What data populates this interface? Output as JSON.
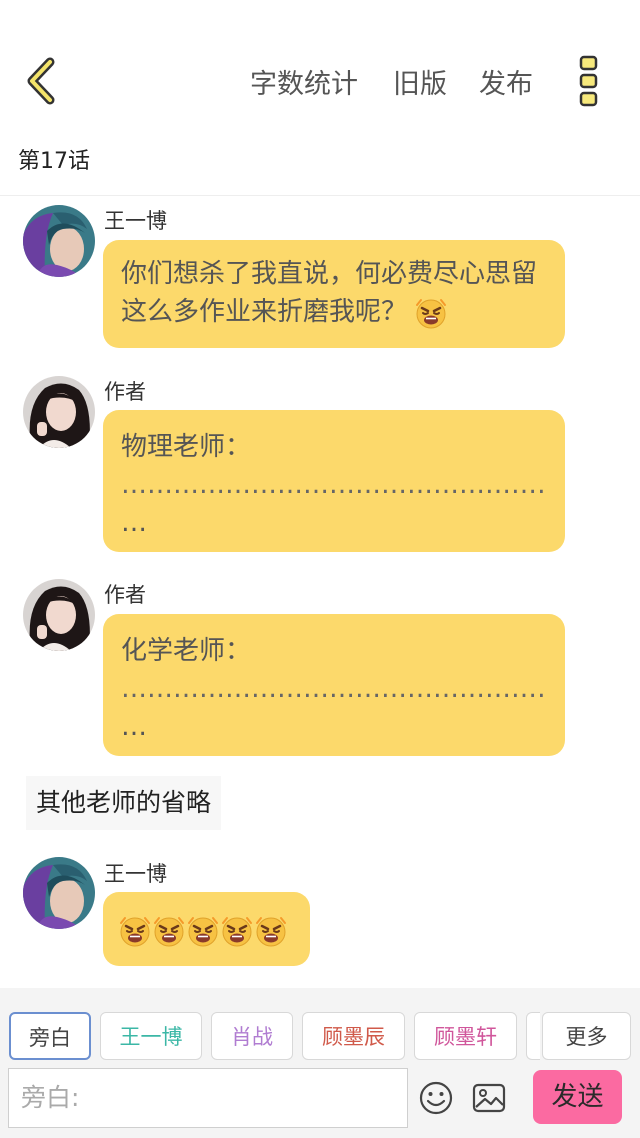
{
  "header": {
    "word_count": "字数统计",
    "old_version": "旧版",
    "publish": "发布",
    "chapter": "第17话"
  },
  "messages": [
    {
      "sender": "王一博",
      "text": "你们想杀了我直说，何必费尽心思留这么多作业来折磨我呢？",
      "emoji": "angry-face"
    },
    {
      "sender": "作者",
      "text": "物理老师：",
      "dots": "………………………………………………",
      "dots2": "…"
    },
    {
      "sender": "作者",
      "text": "化学老师：",
      "dots": "………………………………………………",
      "dots2": "…"
    },
    {
      "sender": "王一博",
      "emoji_count": 5
    }
  ],
  "narration": "其他老师的省略",
  "bottom": {
    "chips": [
      "旁白",
      "王一博",
      "肖战",
      "顾墨辰",
      "顾墨轩",
      "更多"
    ],
    "input_placeholder": "旁白:",
    "send": "发送"
  },
  "colors": {
    "bubble": "#fcd96b",
    "send": "#fb6aa1",
    "chip_wang": "#3bb7a6",
    "chip_xiao": "#b07cd1",
    "chip_gu1": "#d05a4a",
    "chip_gu2": "#d0569b"
  }
}
